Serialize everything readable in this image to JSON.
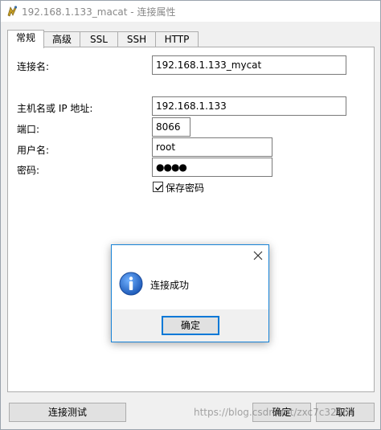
{
  "window": {
    "title": "192.168.1.133_macat - 连接属性"
  },
  "tabs": [
    {
      "label": "常规",
      "active": true
    },
    {
      "label": "高级"
    },
    {
      "label": "SSL"
    },
    {
      "label": "SSH"
    },
    {
      "label": "HTTP"
    }
  ],
  "form": {
    "connection_name_label": "连接名:",
    "connection_name_value": "192.168.1.133_mycat",
    "host_label": "主机名或 IP 地址:",
    "host_value": "192.168.1.133",
    "port_label": "端口:",
    "port_value": "8066",
    "user_label": "用户名:",
    "user_value": "root",
    "password_label": "密码:",
    "password_value": "●●●●",
    "save_password_label": "保存密码",
    "save_password_checked": true
  },
  "dialog": {
    "message": "连接成功",
    "ok_label": "确定"
  },
  "footer": {
    "test_button": "连接测试",
    "ok_button": "确定",
    "cancel_button": "取消"
  },
  "watermark": "https://blog.csdn.net/zxc7c3296"
}
